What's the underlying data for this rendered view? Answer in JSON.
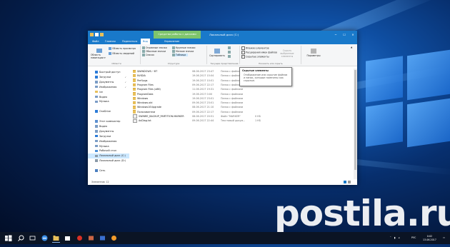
{
  "window": {
    "title": "Локальный диск (C:)",
    "context_tab": "Средства работы с дисками",
    "min": "–",
    "max": "☐",
    "close": "✕"
  },
  "tabs": [
    "Файл",
    "Главная",
    "Поделиться",
    "Вид",
    "Управление"
  ],
  "ribbon": {
    "area_pane": "Область навигации ▾",
    "area_preview": "Область просмотра",
    "area_details": "Область сведений",
    "group_areas": "Области",
    "layout": [
      "Огромные значки",
      "Обычные значки",
      "Список",
      "Крупные значки",
      "Мелкие значки",
      "Таблица"
    ],
    "group_structure": "Структура",
    "sort": "Сортировать",
    "group_current": "Текущее представление",
    "checks": [
      "Флажки элементов",
      "Расширения имен файлов",
      "Скрытые элементы"
    ],
    "hide_selected": "Скрыть выбранные элементы",
    "group_show": "Показать или скрыть",
    "params": "Параметры"
  },
  "tooltip": {
    "title": "Скрытые элементы",
    "body": "Отображение или скрытие файлов и папок, которые помечены как скрытые."
  },
  "nav": [
    {
      "label": "Быстрый доступ",
      "icon": "star-icon",
      "pin": false,
      "sel": false
    },
    {
      "label": "Загрузки",
      "icon": "download-icon",
      "pin": true,
      "sel": false
    },
    {
      "label": "Документы",
      "icon": "documents-icon",
      "pin": true,
      "sel": false
    },
    {
      "label": "Изображения",
      "icon": "pictures-icon",
      "pin": true,
      "sel": false
    },
    {
      "label": "ice",
      "icon": "folder-icon",
      "pin": false,
      "sel": false
    },
    {
      "label": "Видео",
      "icon": "video-icon",
      "pin": false,
      "sel": false
    },
    {
      "label": "Музыка",
      "icon": "music-icon",
      "pin": false,
      "sel": false
    },
    {
      "label": "",
      "icon": "",
      "pin": false,
      "sel": false
    },
    {
      "label": "OneDrive",
      "icon": "cloud-icon",
      "pin": false,
      "sel": false
    },
    {
      "label": "",
      "icon": "",
      "pin": false,
      "sel": false
    },
    {
      "label": "Этот компьютер",
      "icon": "computer-icon",
      "pin": false,
      "sel": false
    },
    {
      "label": "Видео",
      "icon": "video-icon",
      "pin": false,
      "sel": false
    },
    {
      "label": "Документы",
      "icon": "documents-icon",
      "pin": false,
      "sel": false
    },
    {
      "label": "Загрузки",
      "icon": "download-icon",
      "pin": false,
      "sel": false
    },
    {
      "label": "Изображения",
      "icon": "pictures-icon",
      "pin": false,
      "sel": false
    },
    {
      "label": "Музыка",
      "icon": "music-icon",
      "pin": false,
      "sel": false
    },
    {
      "label": "Рабочий стол",
      "icon": "desktop-icon",
      "pin": false,
      "sel": false
    },
    {
      "label": "Локальный диск (C:)",
      "icon": "drive-icon",
      "pin": false,
      "sel": true
    },
    {
      "label": "Локальный диск (D:)",
      "icon": "drive-icon",
      "pin": false,
      "sel": false
    },
    {
      "label": "",
      "icon": "",
      "pin": false,
      "sel": false
    },
    {
      "label": "Сеть",
      "icon": "network-icon",
      "pin": false,
      "sel": false
    }
  ],
  "files": [
    {
      "name": "$WINDOWS.~BT",
      "date": "08.06.2017 23:47",
      "type": "Папка с файлами",
      "size": "",
      "folder": true
    },
    {
      "name": "NVIDIA",
      "date": "19.06.2017 15:04",
      "type": "Папка с файлами",
      "size": "",
      "folder": true
    },
    {
      "name": "PerfLogs",
      "date": "19.06.2017 10:01",
      "type": "Папка с файлами",
      "size": "",
      "folder": true
    },
    {
      "name": "Program Files",
      "date": "09.06.2017 22:17",
      "type": "Папка с файлами",
      "size": "",
      "folder": true
    },
    {
      "name": "Program Files (x86)",
      "date": "11.06.2017 19:31",
      "type": "Папка с файлами",
      "size": "",
      "folder": true
    },
    {
      "name": "ProgramData",
      "date": "19.06.2017 0:00",
      "type": "Папка с файлами",
      "size": "",
      "folder": true
    },
    {
      "name": "Windows",
      "date": "19.06.2017 23:01",
      "type": "Папка с файлами",
      "size": "",
      "folder": true
    },
    {
      "name": "Windows.old",
      "date": "09.06.2017 23:01",
      "type": "Папка с файлами",
      "size": "",
      "folder": true
    },
    {
      "name": "Windows10Upgrade",
      "date": "08.06.2017 21:10",
      "type": "Папка с файлами",
      "size": "",
      "folder": true
    },
    {
      "name": "Пользователи",
      "date": "09.06.2017 22:17",
      "type": "Папка с файлами",
      "size": "",
      "folder": true
    },
    {
      "name": "SWINRE_BACKUP_PARTITION.MARKER",
      "date": "08.06.2017 20:51",
      "type": "Файл \"MARKER\"",
      "size": "0 КБ",
      "folder": false
    },
    {
      "name": "AvDiag.txt",
      "date": "09.06.2017 22:44",
      "type": "Текстовый докум...",
      "size": "1 КБ",
      "folder": false
    }
  ],
  "status": "Элементов: 12",
  "taskbar": {
    "lang": "РУС",
    "time": "0:02",
    "date": "13.06.2017"
  },
  "watermark": "postila.ru"
}
